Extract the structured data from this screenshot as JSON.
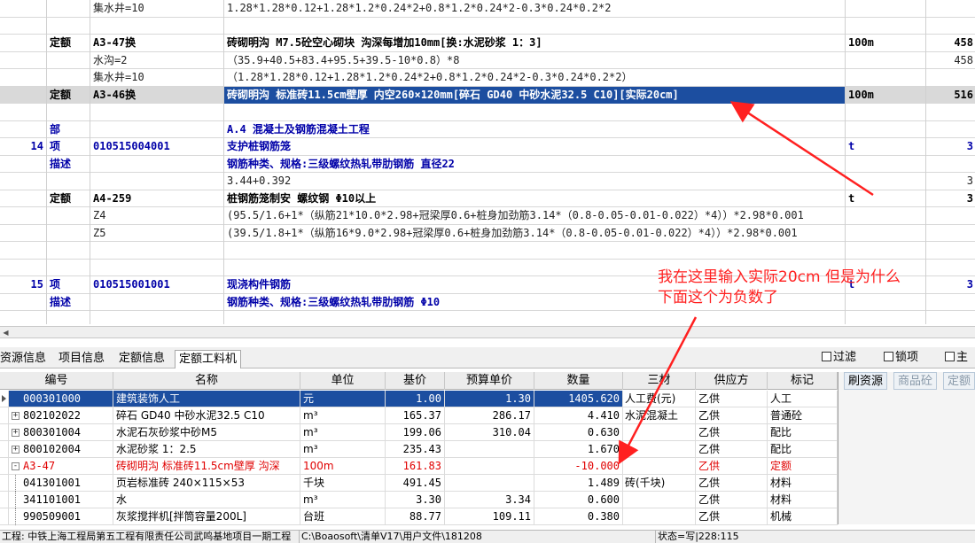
{
  "upper_rows": [
    {
      "c0": "",
      "c1": "",
      "c2": "集水井=10",
      "c3": "1.28*1.28*0.12+1.28*1.2*0.24*2+0.8*1.2*0.24*2-0.3*0.24*0.2*2",
      "c4": "",
      "c5": "",
      "style": "plain"
    },
    {
      "c0": "",
      "c1": "",
      "c2": "",
      "c3": "",
      "c4": "",
      "c5": "",
      "style": "plain"
    },
    {
      "c0": "",
      "c1": "定额",
      "c2": "A3-47换",
      "c3": "砖砌明沟 M7.5砼空心砌块 沟深每增加10mm[换:水泥砂浆 1：3]",
      "c4": "100m",
      "c5": "458",
      "style": "bold"
    },
    {
      "c0": "",
      "c1": "",
      "c2": "水沟=2",
      "c3": "（35.9+40.5+83.4+95.5+39.5-10*0.8）*8",
      "c4": "",
      "c5": "458",
      "style": "plain"
    },
    {
      "c0": "",
      "c1": "",
      "c2": "集水井=10",
      "c3": "（1.28*1.28*0.12+1.28*1.2*0.24*2+0.8*1.2*0.24*2-0.3*0.24*0.2*2）",
      "c4": "",
      "c5": "",
      "style": "plain"
    },
    {
      "c0": "",
      "c1": "定额",
      "c2": "A3-46换",
      "c3": "砖砌明沟 标准砖11.5cm壁厚 内空260×120mm[碎石 GD40 中砂水泥32.5 C10][实际20cm]",
      "c4": "100m",
      "c5": "516",
      "style": "selected"
    },
    {
      "c0": "",
      "c1": "",
      "c2": "",
      "c3": "",
      "c4": "",
      "c5": "",
      "style": "plain"
    },
    {
      "c0": "",
      "c1": "部",
      "c2": "",
      "c3": "A.4 混凝土及钢筋混凝土工程",
      "c4": "",
      "c5": "",
      "style": "bluebold"
    },
    {
      "c0": "14",
      "c1": "项",
      "c2": "010515004001",
      "c3": "支护桩钢筋笼",
      "c4": "t",
      "c5": "3",
      "style": "bluebold"
    },
    {
      "c0": "",
      "c1": "描述",
      "c2": "",
      "c3": "钢筋种类、规格:三级螺纹热轧带肋钢筋 直径22",
      "c4": "",
      "c5": "",
      "style": "bluebold"
    },
    {
      "c0": "",
      "c1": "",
      "c2": "",
      "c3": "3.44+0.392",
      "c4": "",
      "c5": "3",
      "style": "plain"
    },
    {
      "c0": "",
      "c1": "定额",
      "c2": "A4-259",
      "c3": "桩钢筋笼制安 螺纹钢 Φ10以上",
      "c4": "t",
      "c5": "3",
      "style": "bold"
    },
    {
      "c0": "",
      "c1": "",
      "c2": "Z4",
      "c3": "(95.5/1.6+1*（纵筋21*10.0*2.98+冠梁厚0.6+桩身加劲筋3.14*（0.8-0.05-0.01-0.022）*4））*2.98*0.001",
      "c4": "",
      "c5": "",
      "style": "plain"
    },
    {
      "c0": "",
      "c1": "",
      "c2": "Z5",
      "c3": "(39.5/1.8+1*（纵筋16*9.0*2.98+冠梁厚0.6+桩身加劲筋3.14*（0.8-0.05-0.01-0.022）*4））*2.98*0.001",
      "c4": "",
      "c5": "",
      "style": "plain"
    },
    {
      "c0": "",
      "c1": "",
      "c2": "",
      "c3": "",
      "c4": "",
      "c5": "",
      "style": "plain"
    },
    {
      "c0": "",
      "c1": "",
      "c2": "",
      "c3": "",
      "c4": "",
      "c5": "",
      "style": "plain"
    },
    {
      "c0": "15",
      "c1": "项",
      "c2": "010515001001",
      "c3": "现浇构件钢筋",
      "c4": "t",
      "c5": "3",
      "style": "bluebold"
    },
    {
      "c0": "",
      "c1": "描述",
      "c2": "",
      "c3": "钢筋种类、规格:三级螺纹热轧带肋钢筋 Φ10",
      "c4": "",
      "c5": "",
      "style": "bluebold"
    }
  ],
  "tabs": [
    "资源信息",
    "项目信息",
    "定额信息",
    "定额工料机"
  ],
  "checkboxes": [
    "过滤",
    "锁项",
    "主"
  ],
  "lower_headers": [
    "编号",
    "名称",
    "单位",
    "基价",
    "预算单价",
    "数量",
    "三材",
    "供应方",
    "标记"
  ],
  "lower_rows": [
    {
      "code": "000301000",
      "name": "建筑装饰人工",
      "unit": "元",
      "base": "1.00",
      "budget": "1.30",
      "qty": "1405.620",
      "mat": "人工费(元)",
      "supplier": "乙供",
      "mark": "人工",
      "style": "selected",
      "exp": "none"
    },
    {
      "code": "802102022",
      "name": "碎石 GD40 中砂水泥32.5 C10",
      "unit": "m³",
      "base": "165.37",
      "budget": "286.17",
      "qty": "4.410",
      "mat": "水泥混凝土",
      "supplier": "乙供",
      "mark": "普通砼",
      "style": "normal",
      "exp": "plus"
    },
    {
      "code": "800301004",
      "name": "水泥石灰砂浆中砂M5",
      "unit": "m³",
      "base": "199.06",
      "budget": "310.04",
      "qty": "0.630",
      "mat": "",
      "supplier": "乙供",
      "mark": "配比",
      "style": "normal",
      "exp": "plus"
    },
    {
      "code": "800102004",
      "name": "水泥砂浆 1：2.5",
      "unit": "m³",
      "base": "235.43",
      "budget": "",
      "qty": "1.670",
      "mat": "",
      "supplier": "乙供",
      "mark": "配比",
      "style": "normal",
      "exp": "plus"
    },
    {
      "code": "A3-47",
      "name": "砖砌明沟 标准砖11.5cm壁厚 沟深",
      "unit": "100m",
      "base": "161.83",
      "budget": "",
      "qty": "-10.000",
      "mat": "",
      "supplier": "乙供",
      "mark": "定额",
      "style": "red",
      "exp": "minus"
    },
    {
      "code": "041301001",
      "name": "页岩标准砖 240×115×53",
      "unit": "千块",
      "base": "491.45",
      "budget": "",
      "qty": "1.489",
      "mat": "砖(千块)",
      "supplier": "乙供",
      "mark": "材料",
      "style": "normal",
      "exp": "line"
    },
    {
      "code": "341101001",
      "name": "水",
      "unit": "m³",
      "base": "3.30",
      "budget": "3.34",
      "qty": "0.600",
      "mat": "",
      "supplier": "乙供",
      "mark": "材料",
      "style": "normal",
      "exp": "line"
    },
    {
      "code": "990509001",
      "name": "灰浆搅拌机[拌筒容量200L]",
      "unit": "台班",
      "base": "88.77",
      "budget": "109.11",
      "qty": "0.380",
      "mat": "",
      "supplier": "乙供",
      "mark": "机械",
      "style": "normal",
      "exp": "line"
    }
  ],
  "side_tabs": [
    "刷资源",
    "商品砼",
    "定额"
  ],
  "status": {
    "project": "工程: 中铁上海工程局第五工程有限责任公司武鸣基地项目一期工程",
    "path": "C:\\Boaosoft\\清单V17\\用户文件\\181208",
    "state": "状态=写|228:115"
  },
  "annotation": {
    "line1": "我在这里输入实际20cm  但是为什么",
    "line2": "下面这个为负数了",
    "color": "#ff2020"
  },
  "colors": {
    "selection": "#1c4ea0",
    "blue_text": "#0000a8",
    "red_text": "#e00000"
  }
}
